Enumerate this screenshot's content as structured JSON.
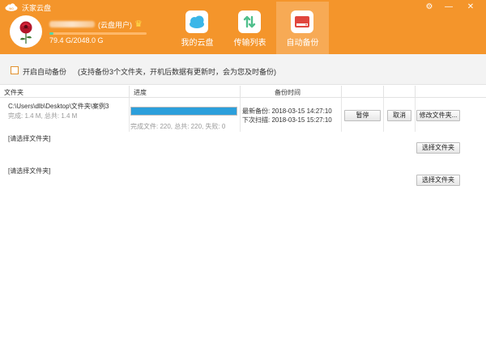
{
  "app": {
    "title": "沃家云盘"
  },
  "user": {
    "type_label": "(云盘用户)",
    "storage_text": "79.4 G/2048.0 G",
    "storage_used_fraction": 0.039
  },
  "nav": [
    {
      "label": "我的云盘",
      "icon": "cloud-icon",
      "color": "#3ab6e8"
    },
    {
      "label": "传输列表",
      "icon": "transfer-icon",
      "color": "#4fbf8c"
    },
    {
      "label": "自动备份",
      "icon": "backup-drive-icon",
      "color": "#e0463e"
    }
  ],
  "options": {
    "auto_backup_label": "开启自动备份",
    "hint": "(支持备份3个文件夹，开机后数据有更新时，会为您及时备份)"
  },
  "table": {
    "headers": {
      "folder": "文件夹",
      "progress": "进度",
      "time": "备份时间"
    }
  },
  "rows": [
    {
      "path": "C:\\Users\\dlb\\Desktop\\文件夹\\案例3",
      "size": "完成: 1.4 M, 总共: 1.4 M",
      "progress_fraction": 1.0,
      "progress_text": "完成文件: 220, 总共: 220, 失败: 0",
      "last_backup": "最新备份: 2018-03-15 14:27:10",
      "next_scan": "下次扫描: 2018-03-15 15:27:10",
      "pause": "暂停",
      "cancel": "取消",
      "modify": "修改文件夹..."
    },
    {
      "placeholder": "[请选择文件夹]",
      "select": "选择文件夹"
    },
    {
      "placeholder": "[请选择文件夹]",
      "select": "选择文件夹"
    }
  ],
  "colors": {
    "accent": "#f4952b",
    "progress": "#2c9fdb"
  }
}
